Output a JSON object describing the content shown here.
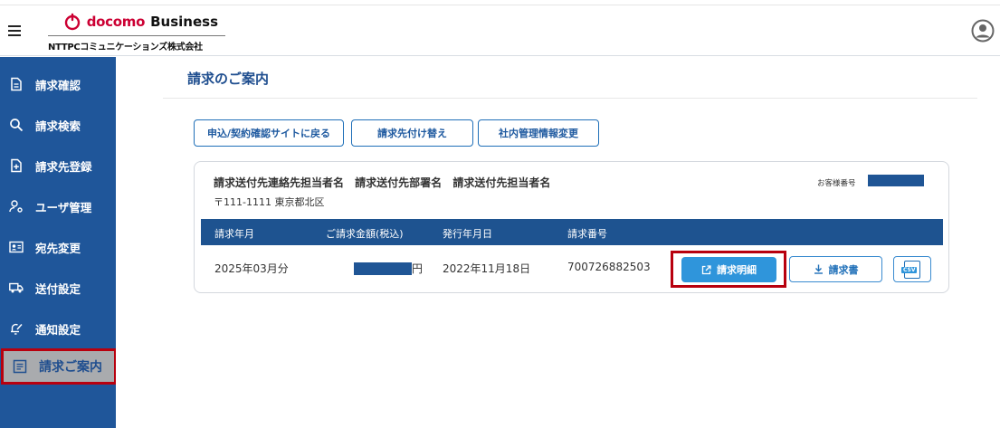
{
  "header": {
    "brand": "docomo",
    "business": "Business",
    "company": "NTTPCコミュニケーションズ株式会社"
  },
  "sidebar": {
    "items": [
      {
        "label": "請求確認",
        "icon": "document-icon"
      },
      {
        "label": "請求検索",
        "icon": "search-icon"
      },
      {
        "label": "請求先登録",
        "icon": "add-document-icon"
      },
      {
        "label": "ユーザ管理",
        "icon": "user-settings-icon"
      },
      {
        "label": "宛先変更",
        "icon": "contact-card-icon"
      },
      {
        "label": "送付設定",
        "icon": "truck-icon"
      },
      {
        "label": "通知設定",
        "icon": "bell-edit-icon"
      },
      {
        "label": "請求ご案内",
        "icon": "list-document-icon",
        "active": true
      }
    ]
  },
  "main": {
    "title": "請求のご案内",
    "buttons": {
      "back": "申込/契約確認サイトに戻る",
      "switch": "請求先付け替え",
      "internal": "社内管理情報変更"
    },
    "card": {
      "recipient": "請求送付先連絡先担当者名 請求送付先部署名 請求送付先担当者名",
      "address": "〒111-1111 東京都北区",
      "customer_label": "お客様番号",
      "columns": [
        "請求年月",
        "ご請求金額(税込)",
        "発行年月日",
        "請求番号"
      ],
      "row": {
        "month": "2025年03月分",
        "amount_suffix": "円",
        "issued": "2022年11月18日",
        "number": "700726882503"
      },
      "actions": {
        "detail": "請求明細",
        "invoice": "請求書",
        "csv": "CSV"
      }
    }
  },
  "colors": {
    "sidebar": "#1f569a",
    "accent": "#2f95db",
    "highlight": "#b8000e",
    "brand_red": "#cc0033"
  }
}
